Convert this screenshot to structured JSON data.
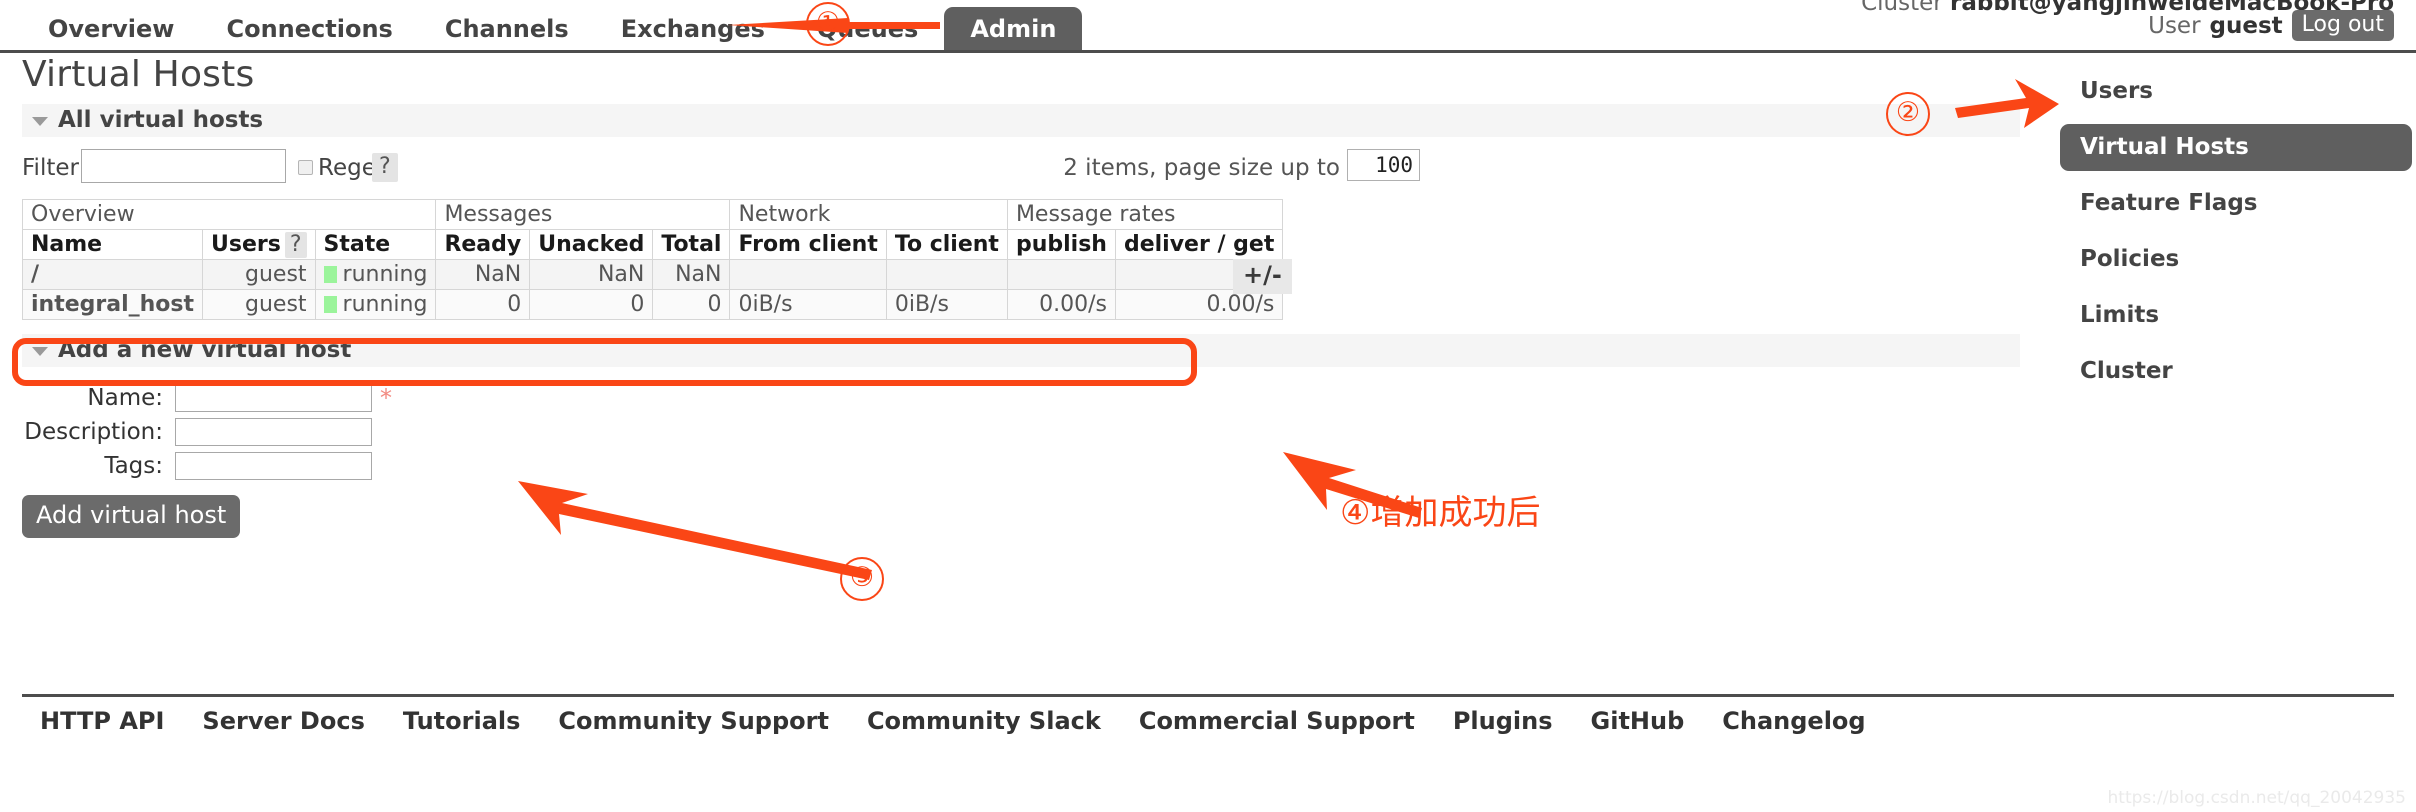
{
  "nav": {
    "tabs": [
      {
        "label": "Overview",
        "active": false
      },
      {
        "label": "Connections",
        "active": false
      },
      {
        "label": "Channels",
        "active": false
      },
      {
        "label": "Exchanges",
        "active": false
      },
      {
        "label": "Queues",
        "active": false
      },
      {
        "label": "Admin",
        "active": true
      }
    ]
  },
  "header": {
    "cluster_prefix": "Cluster ",
    "cluster_name": "rabbit@yangjinweideMacBook-Pro",
    "user_prefix": "User ",
    "user_name": "guest",
    "logout_label": "Log out"
  },
  "sidebar": {
    "items": [
      {
        "label": "Users",
        "active": false
      },
      {
        "label": "Virtual Hosts",
        "active": true
      },
      {
        "label": "Feature Flags",
        "active": false
      },
      {
        "label": "Policies",
        "active": false
      },
      {
        "label": "Limits",
        "active": false
      },
      {
        "label": "Cluster",
        "active": false
      }
    ]
  },
  "main": {
    "page_title": "Virtual Hosts",
    "all_section_title": "All virtual hosts",
    "filter": {
      "label": "Filter:",
      "value": "",
      "placeholder": "",
      "regex_label": "Regex",
      "help_label": "?"
    },
    "paging": {
      "text": "2 items, page size up to",
      "page_size": "100"
    },
    "table": {
      "plus_minus_label": "+/-",
      "group_headers": [
        {
          "label": "Overview",
          "span": 3
        },
        {
          "label": "Messages",
          "span": 3
        },
        {
          "label": "Network",
          "span": 2
        },
        {
          "label": "Message rates",
          "span": 2
        }
      ],
      "columns": [
        {
          "label": "Name",
          "align": "left"
        },
        {
          "label": "Users",
          "align": "left",
          "help": "?"
        },
        {
          "label": "State",
          "align": "left"
        },
        {
          "label": "Ready",
          "align": "right"
        },
        {
          "label": "Unacked",
          "align": "right"
        },
        {
          "label": "Total",
          "align": "right"
        },
        {
          "label": "From client",
          "align": "left"
        },
        {
          "label": "To client",
          "align": "left"
        },
        {
          "label": "publish",
          "align": "right"
        },
        {
          "label": "deliver / get",
          "align": "right"
        }
      ],
      "rows": [
        {
          "name": "/",
          "users": "guest",
          "state": "running",
          "ready": "NaN",
          "unacked": "NaN",
          "total": "NaN",
          "from_client": "",
          "to_client": "",
          "publish": "",
          "deliver_get": ""
        },
        {
          "name": "integral_host",
          "users": "guest",
          "state": "running",
          "ready": "0",
          "unacked": "0",
          "total": "0",
          "from_client": "0iB/s",
          "to_client": "0iB/s",
          "publish": "0.00/s",
          "deliver_get": "0.00/s"
        }
      ]
    },
    "add_section": {
      "title": "Add a new virtual host",
      "fields": [
        {
          "label": "Name:",
          "value": "",
          "required_marker": "*"
        },
        {
          "label": "Description:",
          "value": "",
          "required_marker": ""
        },
        {
          "label": "Tags:",
          "value": "",
          "required_marker": ""
        }
      ],
      "submit_label": "Add virtual host"
    }
  },
  "footer": {
    "links": [
      "HTTP API",
      "Server Docs",
      "Tutorials",
      "Community Support",
      "Community Slack",
      "Commercial Support",
      "Plugins",
      "GitHub",
      "Changelog"
    ],
    "watermark": "https://blog.csdn.net/qq_20042935"
  },
  "annotations": {
    "accent_color": "#fa4616",
    "markers": [
      {
        "label": "①"
      },
      {
        "label": "②"
      },
      {
        "label": "③"
      }
    ],
    "note_4": "④增加成功后"
  }
}
